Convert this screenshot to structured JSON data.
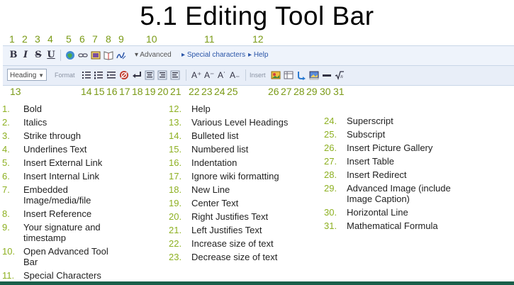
{
  "title": "5.1  Editing Tool Bar",
  "top_numbers": [
    "1",
    "2",
    "3",
    "4",
    "5",
    "6",
    "7",
    "8",
    "9",
    "10",
    "11",
    "12"
  ],
  "bottom_numbers": [
    "13",
    "14",
    "15",
    "16",
    "17",
    "18",
    "19",
    "20",
    "21",
    "22",
    "23",
    "24",
    "25",
    "26",
    "27",
    "28",
    "29",
    "30",
    "31"
  ],
  "toolbar": {
    "bold": "B",
    "italic": "I",
    "strike": "S",
    "underline": "U",
    "advanced": "Advanced",
    "special": "Special characters",
    "help": "Help",
    "heading_value": "Heading",
    "format_label": "Format",
    "insert_label": "Insert",
    "grow1": "A⁺",
    "grow2": "A⁻",
    "grow3": "A˙",
    "shrink": "A₋"
  },
  "items_col1": [
    {
      "n": "1.",
      "t": "Bold"
    },
    {
      "n": "2.",
      "t": "Italics"
    },
    {
      "n": "3.",
      "t": "Strike through"
    },
    {
      "n": "4.",
      "t": "Underlines Text"
    },
    {
      "n": "5.",
      "t": "Insert External Link"
    },
    {
      "n": "6.",
      "t": "Insert Internal Link"
    },
    {
      "n": "7.",
      "t": "Embedded",
      "t2": "Image/media/file"
    },
    {
      "n": "8.",
      "t": "Insert Reference"
    },
    {
      "n": "9.",
      "t": "Your signature and",
      "t2": "timestamp"
    },
    {
      "n": "10.",
      "t": "Open Advanced Tool",
      "t2": "Bar"
    },
    {
      "n": "11.",
      "t": "Special Characters"
    }
  ],
  "items_col2": [
    {
      "n": "12.",
      "t": "Help"
    },
    {
      "n": "13.",
      "t": "Various Level Headings"
    },
    {
      "n": "14.",
      "t": "Bulleted list"
    },
    {
      "n": "15.",
      "t": "Numbered list"
    },
    {
      "n": "16.",
      "t": "Indentation"
    },
    {
      "n": "17.",
      "t": "Ignore wiki formatting"
    },
    {
      "n": "18.",
      "t": "New Line"
    },
    {
      "n": "19.",
      "t": "Center Text"
    },
    {
      "n": "20.",
      "t": "Right Justifies Text"
    },
    {
      "n": "21.",
      "t": "Left Justifies Text"
    },
    {
      "n": "22.",
      "t": "Increase size of text"
    },
    {
      "n": "23.",
      "t": "Decrease size of text"
    }
  ],
  "items_col3": [
    {
      "n": "24.",
      "t": "Superscript"
    },
    {
      "n": "25.",
      "t": "Subscript"
    },
    {
      "n": "26.",
      "t": "Insert Picture Gallery"
    },
    {
      "n": "27.",
      "t": "Insert Table"
    },
    {
      "n": "28.",
      "t": "Insert Redirect"
    },
    {
      "n": "29.",
      "t": "Advanced Image (include",
      "t2": "Image Caption)"
    },
    {
      "n": "30.",
      "t": "Horizontal Line"
    },
    {
      "n": "31.",
      "t": "Mathematical Formula"
    }
  ]
}
